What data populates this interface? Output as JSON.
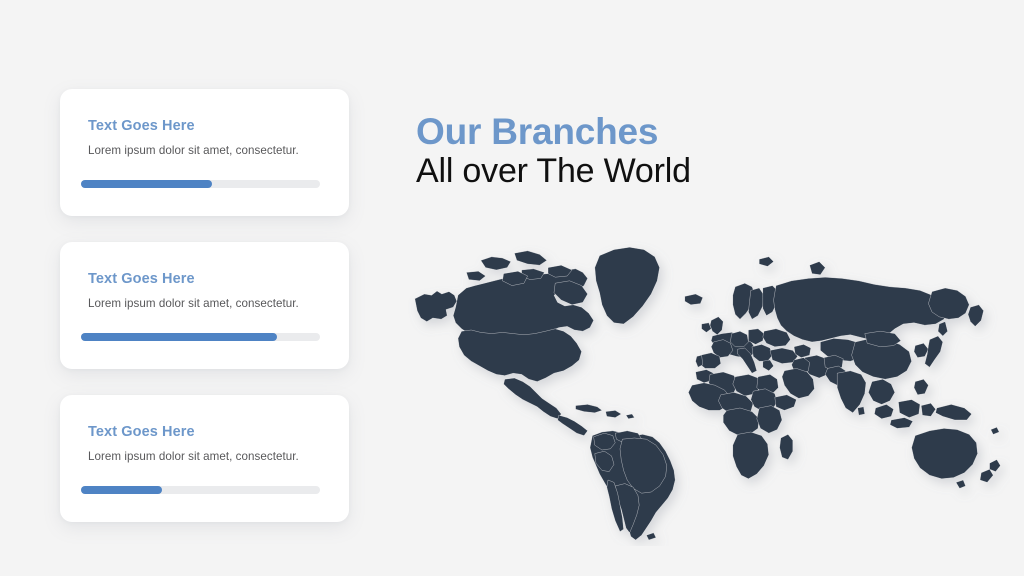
{
  "background_color": "#f4f4f4",
  "accent_color": "#6d97ca",
  "bar_fill_color": "#4e83c4",
  "bar_track_color": "#eaebed",
  "map_land_color": "#2e3a4b",
  "heading": {
    "line1": "Our Branches",
    "line2": "All over The World"
  },
  "cards": [
    {
      "title": "Text Goes Here",
      "description": "Lorem ipsum dolor sit amet, consectetur.",
      "progress": 55
    },
    {
      "title": "Text Goes Here",
      "description": "Lorem ipsum dolor sit amet, consectetur.",
      "progress": 82
    },
    {
      "title": "Text Goes Here",
      "description": "Lorem ipsum dolor sit amet, consectetur.",
      "progress": 34
    }
  ],
  "map": {
    "name": "world-map",
    "projection": "equirectangular"
  }
}
